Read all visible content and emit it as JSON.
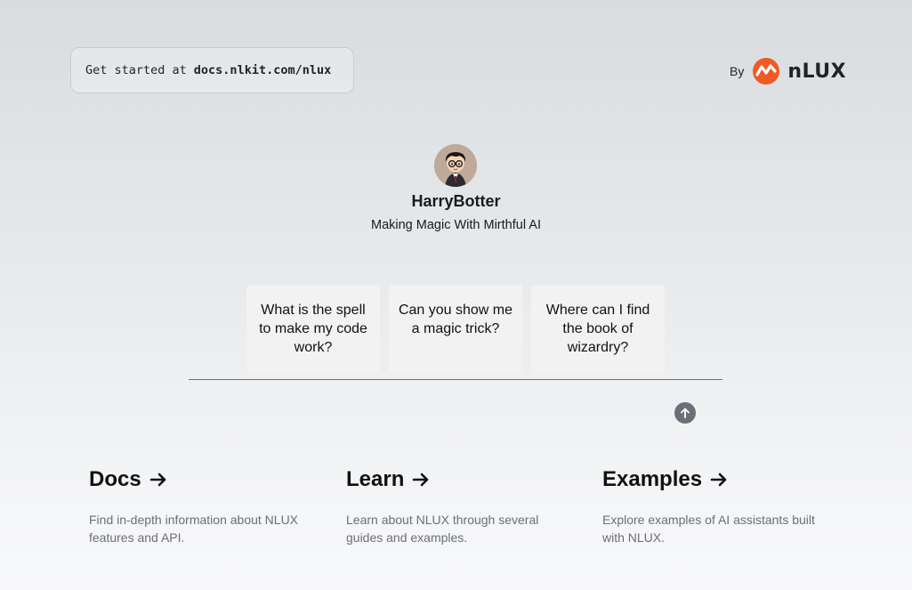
{
  "header": {
    "get_started_prefix": "Get started at",
    "get_started_link": "docs.nlkit.com/nlux",
    "by_label": "By",
    "brand_name": "nLUX",
    "brand_colors": {
      "accent": "#f15a24",
      "accent_dark": "#d94a18"
    }
  },
  "bot": {
    "avatar_icon": "wizard-avatar-icon",
    "name": "HarryBotter",
    "tagline": "Making Magic With Mirthful AI"
  },
  "prompts": [
    {
      "text": "What is the spell to make my code work?"
    },
    {
      "text": "Can you show me a magic trick?"
    },
    {
      "text": "Where can I find the book of wizardry?"
    }
  ],
  "composer": {
    "value": "",
    "placeholder": "",
    "send_icon": "arrow-up-icon",
    "send_button_color": "#6c6f78"
  },
  "cards": [
    {
      "title": "Docs",
      "icon": "arrow-right-icon",
      "description": "Find in-depth information about NLUX features and API."
    },
    {
      "title": "Learn",
      "icon": "arrow-right-icon",
      "description": "Learn about NLUX through several guides and examples."
    },
    {
      "title": "Examples",
      "icon": "arrow-right-icon",
      "description": "Explore examples of AI assistants built with NLUX."
    }
  ]
}
